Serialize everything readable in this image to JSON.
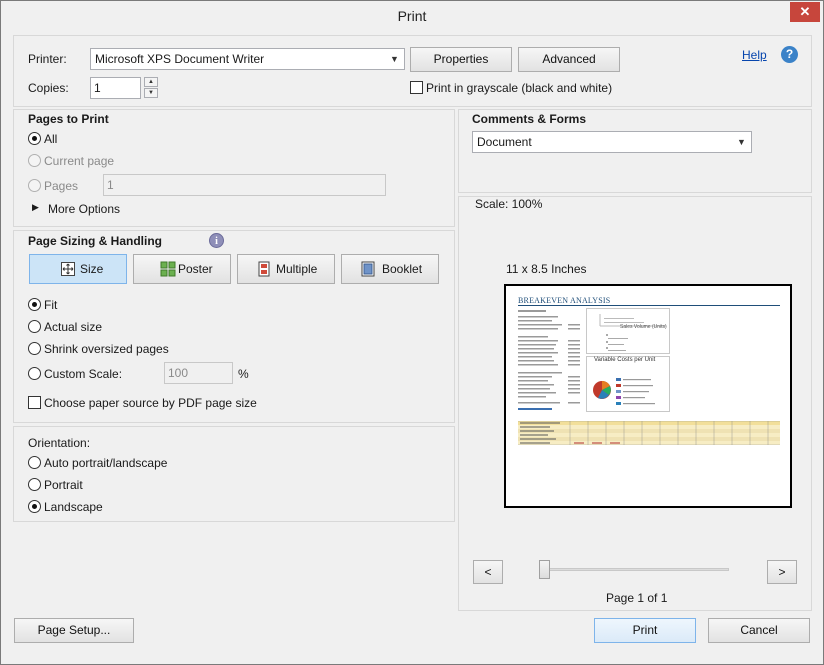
{
  "window": {
    "title": "Print",
    "close_glyph": "✕"
  },
  "printer": {
    "label": "Printer:",
    "selected": "Microsoft XPS Document Writer",
    "properties_label": "Properties",
    "advanced_label": "Advanced",
    "help_label": "Help",
    "copies_label": "Copies:",
    "copies_value": "1",
    "grayscale_label": "Print in grayscale (black and white)"
  },
  "pages_to_print": {
    "heading": "Pages to Print",
    "all_label": "All",
    "current_label": "Current page",
    "pages_label": "Pages",
    "pages_value": "1",
    "more_options_label": "More Options"
  },
  "page_sizing": {
    "heading": "Page Sizing & Handling",
    "modes": [
      {
        "label": "Size",
        "icon": "size-icon",
        "active": true
      },
      {
        "label": "Poster",
        "icon": "poster-icon",
        "active": false
      },
      {
        "label": "Multiple",
        "icon": "multiple-icon",
        "active": false
      },
      {
        "label": "Booklet",
        "icon": "booklet-icon",
        "active": false
      }
    ],
    "fit_label": "Fit",
    "actual_label": "Actual size",
    "shrink_label": "Shrink oversized pages",
    "custom_label": "Custom Scale:",
    "custom_value": "100",
    "percent_label": "%",
    "paper_source_label": "Choose paper source by PDF page size"
  },
  "orientation": {
    "heading": "Orientation:",
    "auto_label": "Auto portrait/landscape",
    "portrait_label": "Portrait",
    "landscape_label": "Landscape"
  },
  "comments_forms": {
    "heading": "Comments & Forms",
    "selected": "Document"
  },
  "preview": {
    "scale_label": "Scale: 100%",
    "size_label": "11 x 8.5 Inches",
    "doc_title": "BREAKEVEN ANALYSIS",
    "chart1_title": "Sales Volume (Units)",
    "chart2_title": "Variable Costs per Unit",
    "page_label": "Page 1 of 1",
    "prev_glyph": "<",
    "next_glyph": ">"
  },
  "footer": {
    "page_setup_label": "Page Setup...",
    "print_label": "Print",
    "cancel_label": "Cancel"
  },
  "colors": {
    "accent": "#3b82c8",
    "doc_title": "#1f4e79",
    "table_header": "#f2df9a",
    "table_rows": "#f7edc4"
  }
}
